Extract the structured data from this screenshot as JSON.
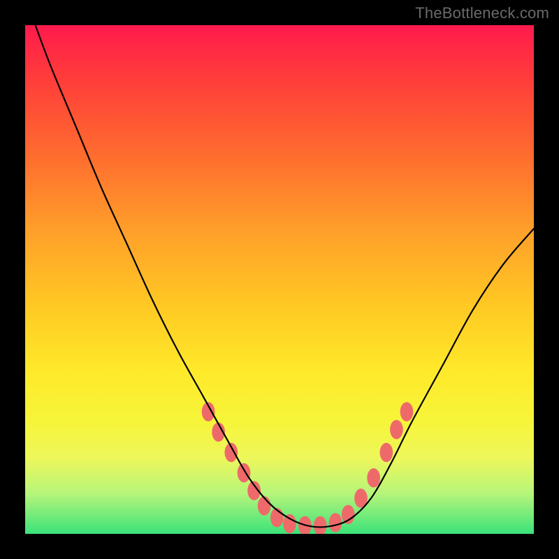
{
  "watermark": "TheBottleneck.com",
  "chart_data": {
    "type": "line",
    "title": "",
    "xlabel": "",
    "ylabel": "",
    "xlim": [
      0,
      100
    ],
    "ylim": [
      0,
      100
    ],
    "grid": false,
    "legend": false,
    "series": [
      {
        "name": "bottleneck-curve",
        "color": "#000000",
        "x": [
          2,
          5,
          10,
          15,
          20,
          25,
          30,
          35,
          40,
          44,
          48,
          52,
          56,
          60,
          64,
          68,
          72,
          76,
          82,
          88,
          94,
          100
        ],
        "y": [
          100,
          92,
          80,
          68,
          57,
          46,
          36,
          27,
          18,
          11,
          6,
          3,
          1.5,
          1.5,
          3,
          7,
          14,
          22,
          33,
          44,
          53,
          60
        ]
      }
    ],
    "markers": [
      {
        "name": "dot-cluster",
        "color": "#ee6a6a",
        "radius_px": 11,
        "points": [
          {
            "x": 36,
            "y": 24
          },
          {
            "x": 38,
            "y": 20
          },
          {
            "x": 40.5,
            "y": 16
          },
          {
            "x": 43,
            "y": 12
          },
          {
            "x": 45,
            "y": 8.5
          },
          {
            "x": 47,
            "y": 5.5
          },
          {
            "x": 49.5,
            "y": 3.2
          },
          {
            "x": 52,
            "y": 2.0
          },
          {
            "x": 55,
            "y": 1.6
          },
          {
            "x": 58,
            "y": 1.6
          },
          {
            "x": 61,
            "y": 2.2
          },
          {
            "x": 63.5,
            "y": 3.8
          },
          {
            "x": 66,
            "y": 7
          },
          {
            "x": 68.5,
            "y": 11
          },
          {
            "x": 71,
            "y": 16
          },
          {
            "x": 73,
            "y": 20.5
          },
          {
            "x": 75,
            "y": 24
          }
        ]
      }
    ]
  }
}
